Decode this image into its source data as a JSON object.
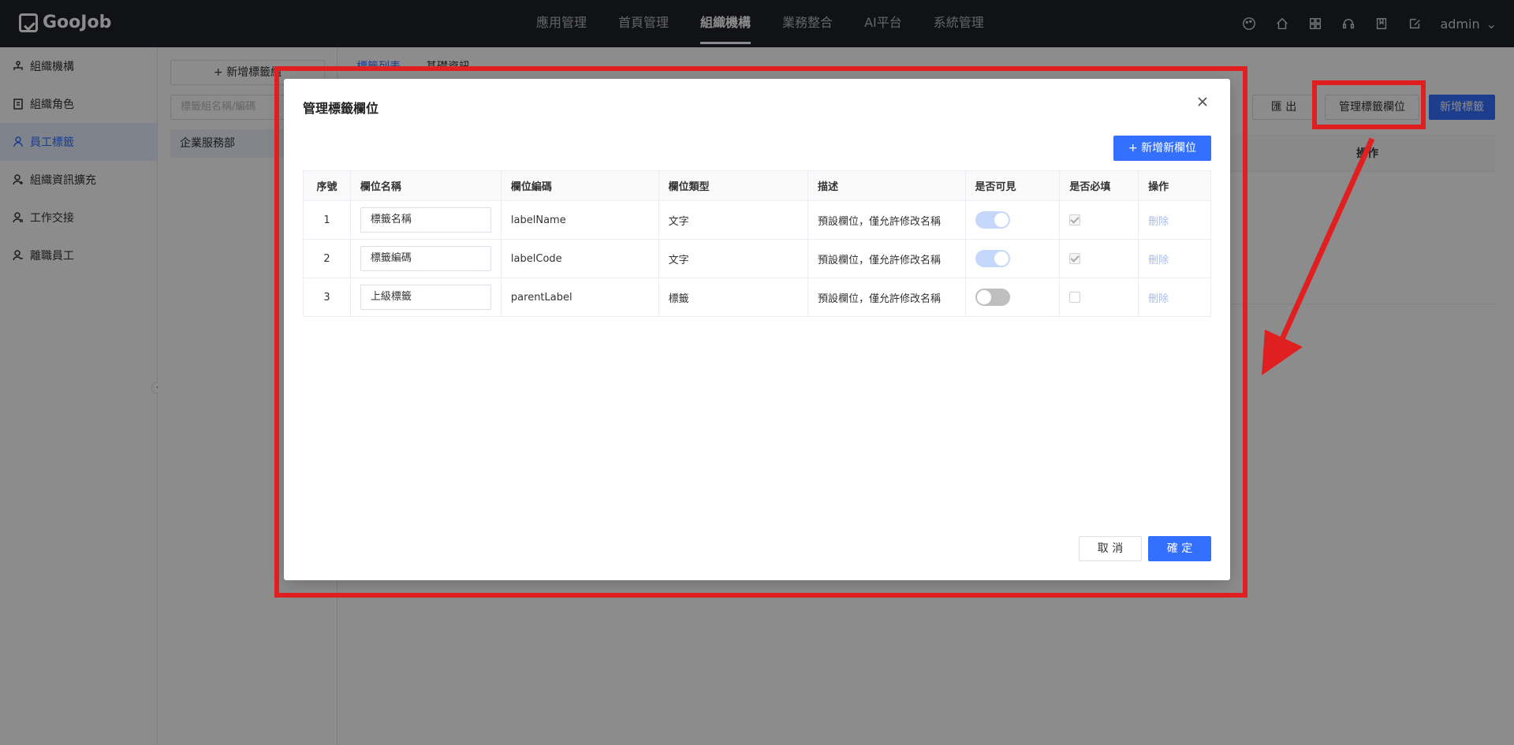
{
  "app": {
    "logo_text": "GooJob"
  },
  "topnav": {
    "items": [
      {
        "label": "應用管理"
      },
      {
        "label": "首頁管理"
      },
      {
        "label": "組織機構"
      },
      {
        "label": "業務整合"
      },
      {
        "label": "AI平台"
      },
      {
        "label": "系統管理"
      }
    ],
    "active_index": 2,
    "user": "admin"
  },
  "sidebar": {
    "items": [
      {
        "label": "組織機構"
      },
      {
        "label": "組織角色"
      },
      {
        "label": "員工標籤"
      },
      {
        "label": "組織資訊擴充"
      },
      {
        "label": "工作交接"
      },
      {
        "label": "離職員工"
      }
    ],
    "active_index": 2
  },
  "left_panel": {
    "add_group_label": "+ 新增標籤組",
    "search_placeholder": "標籤組名稱/編碼",
    "tree_item": "企業服務部"
  },
  "main": {
    "tabs": [
      {
        "label": "標籤列表"
      },
      {
        "label": "基礎資訊"
      }
    ],
    "export_label": "匯 出",
    "manage_fields_label": "管理標籤欄位",
    "new_label_label": "新增標籤",
    "column_action": "操作"
  },
  "modal": {
    "title": "管理標籤欄位",
    "add_field_label": "+ 新增新欄位",
    "columns": [
      "序號",
      "欄位名稱",
      "欄位編碼",
      "欄位類型",
      "描述",
      "是否可見",
      "是否必填",
      "操作"
    ],
    "rows": [
      {
        "index": "1",
        "name": "標籤名稱",
        "code": "labelName",
        "type": "文字",
        "desc": "預設欄位，僅允許修改名稱",
        "visible": true,
        "required": true,
        "action": "刪除"
      },
      {
        "index": "2",
        "name": "標籤編碼",
        "code": "labelCode",
        "type": "文字",
        "desc": "預設欄位，僅允許修改名稱",
        "visible": true,
        "required": true,
        "action": "刪除"
      },
      {
        "index": "3",
        "name": "上級標籤",
        "code": "parentLabel",
        "type": "標籤",
        "desc": "預設欄位，僅允許修改名稱",
        "visible": false,
        "required": false,
        "action": "刪除"
      }
    ],
    "cancel_label": "取 消",
    "ok_label": "確 定"
  },
  "colors": {
    "primary": "#3370ff",
    "annotation": "#e02020",
    "topbar": "#1f2128"
  }
}
